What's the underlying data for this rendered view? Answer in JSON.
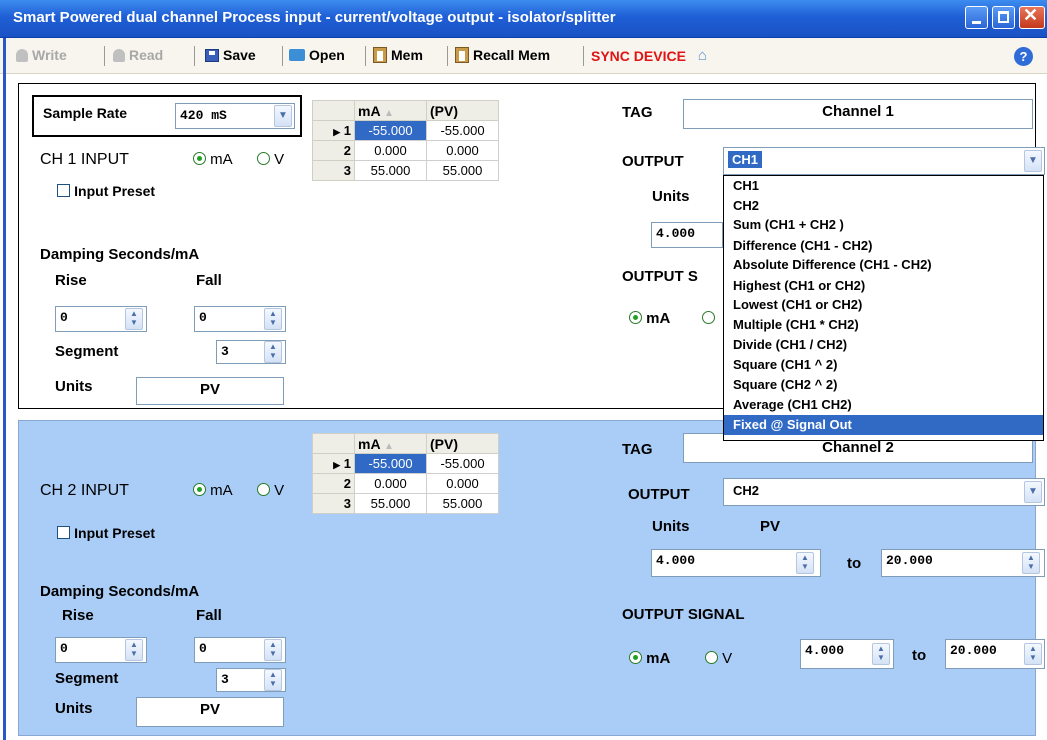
{
  "window": {
    "title": "Smart Powered dual channel Process input  -  current/voltage output - isolator/splitter"
  },
  "toolbar": {
    "write": "Write",
    "read": "Read",
    "save": "Save",
    "open": "Open",
    "mem": "Mem",
    "recall_mem": "Recall Mem",
    "sync_device": "SYNC DEVICE",
    "help": "?"
  },
  "ch1": {
    "sample_rate_label": "Sample Rate",
    "sample_rate_value": "420 mS",
    "input_label": "CH 1  INPUT",
    "input_ma": "mA",
    "input_v": "V",
    "input_selected": "mA",
    "input_preset_label": "Input Preset",
    "table": {
      "headers": [
        "mA",
        "(PV)"
      ],
      "rows": [
        {
          "num": "1",
          "ma": "-55.000",
          "pv": "-55.000"
        },
        {
          "num": "2",
          "ma": "0.000",
          "pv": "0.000"
        },
        {
          "num": "3",
          "ma": "55.000",
          "pv": "55.000"
        }
      ]
    },
    "damping_label": "Damping Seconds/mA",
    "rise_label": "Rise",
    "fall_label": "Fall",
    "rise_value": "0",
    "fall_value": "0",
    "segment_label": "Segment",
    "segment_value": "3",
    "units_label": "Units",
    "units_value": "PV",
    "tag_label": "TAG",
    "tag_value": "Channel 1",
    "output_label": "OUTPUT",
    "output_value": "CH1",
    "out_units_label": "Units",
    "out_from_value": "4.000",
    "output_signal_label": "OUTPUT S",
    "out_ma": "mA"
  },
  "dropdown": {
    "options": [
      "CH1",
      "CH2",
      "Sum (CH1 +  CH2 )",
      "Difference (CH1 - CH2)",
      "Absolute Difference (CH1 - CH2)",
      "Highest (CH1 or CH2)",
      "Lowest (CH1 or CH2)",
      "Multiple (CH1 * CH2)",
      "Divide   (CH1 / CH2)",
      "Square (CH1 ^ 2)",
      "Square (CH2 ^ 2)",
      "Average (CH1 CH2)",
      "Fixed @ Signal Out"
    ],
    "highlighted": "Fixed @ Signal Out"
  },
  "ch2": {
    "input_label": "CH 2  INPUT",
    "input_ma": "mA",
    "input_v": "V",
    "input_selected": "mA",
    "input_preset_label": "Input Preset",
    "table": {
      "headers": [
        "mA",
        "(PV)"
      ],
      "rows": [
        {
          "num": "1",
          "ma": "-55.000",
          "pv": "-55.000"
        },
        {
          "num": "2",
          "ma": "0.000",
          "pv": "0.000"
        },
        {
          "num": "3",
          "ma": "55.000",
          "pv": "55.000"
        }
      ]
    },
    "damping_label": "Damping Seconds/mA",
    "rise_label": "Rise",
    "fall_label": "Fall",
    "rise_value": "0",
    "fall_value": "0",
    "segment_label": "Segment",
    "segment_value": "3",
    "units_label": "Units",
    "units_value": "PV",
    "tag_label": "TAG",
    "tag_value": "Channel 2",
    "output_label": "OUTPUT",
    "output_value": "CH2",
    "out_units_label": "Units",
    "out_units_value": "PV",
    "out_from_value": "4.000",
    "to_label": "to",
    "out_to_value": "20.000",
    "output_signal_label": "OUTPUT SIGNAL",
    "sig_ma": "mA",
    "sig_v": "V",
    "sig_from_value": "4.000",
    "sig_to_value": "20.000"
  },
  "colors": {
    "titlebar": "#1f5fd6",
    "panel2_bg": "#a9cdf6",
    "selection": "#316ac5",
    "sync_red": "#e01414"
  }
}
